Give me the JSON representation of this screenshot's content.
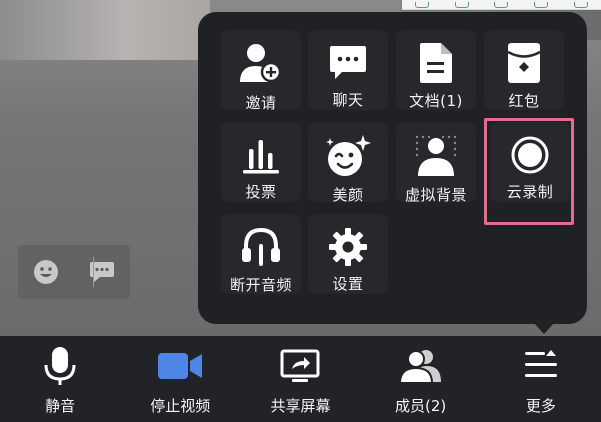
{
  "more_menu": {
    "items": [
      {
        "label": "邀请",
        "icon": "invite-user-icon"
      },
      {
        "label": "聊天",
        "icon": "chat-icon"
      },
      {
        "label": "文档(1)",
        "icon": "document-icon"
      },
      {
        "label": "红包",
        "icon": "red-packet-icon"
      },
      {
        "label": "投票",
        "icon": "vote-icon"
      },
      {
        "label": "美颜",
        "icon": "beauty-icon"
      },
      {
        "label": "虚拟背景",
        "icon": "virtual-background-icon"
      },
      {
        "label": "云录制",
        "icon": "cloud-record-icon"
      },
      {
        "label": "断开音频",
        "icon": "disconnect-audio-icon"
      },
      {
        "label": "设置",
        "icon": "settings-icon"
      }
    ]
  },
  "toolbar": {
    "items": [
      {
        "label": "静音",
        "icon": "microphone-icon"
      },
      {
        "label": "停止视频",
        "icon": "video-camera-icon"
      },
      {
        "label": "共享屏幕",
        "icon": "share-screen-icon"
      },
      {
        "label": "成员(2)",
        "icon": "members-icon"
      },
      {
        "label": "更多",
        "icon": "more-menu-icon"
      }
    ]
  },
  "colors": {
    "popup_bg": "#1f2124",
    "toolbar_bg": "#212327",
    "video_accent": "#4e86e8",
    "highlight": "#e36c8f"
  }
}
